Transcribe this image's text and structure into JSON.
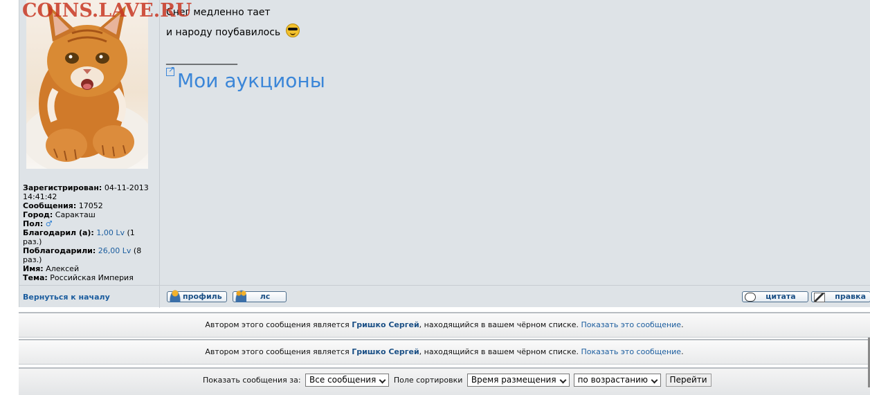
{
  "watermark": "COINS.LAVE.RU",
  "post": {
    "line1": "Снег медленно тает",
    "line2": "и народу поубавилось",
    "smiley_icon": "sunglasses-smiley",
    "signature_separator": "_________________",
    "auction_link": "Мои аукционы"
  },
  "profile": {
    "avatar_alt": "kitten-avatar",
    "registered_label": "Зарегистрирован:",
    "registered_value": "04-11-2013 14:41:42",
    "messages_label": "Сообщения:",
    "messages_value": "17052",
    "city_label": "Город:",
    "city_value": "Саракташ",
    "gender_label": "Пол:",
    "gender_value": "♂",
    "thanked_label": "Благодарил (а):",
    "thanked_amount": "1,00 Lv",
    "thanked_count": "(1 раз.)",
    "thanked_by_label": "Поблагодарили:",
    "thanked_by_amount": "26,00 Lv",
    "thanked_by_count": "(8 раз.)",
    "name_label": "Имя:",
    "name_value": "Алексей",
    "topic_label": "Тема:",
    "topic_value": "Российская Империя"
  },
  "footer": {
    "back_to_top": "Вернуться к началу",
    "profile_button": "профиль",
    "pm_button": "лс",
    "quote_button": "цитата",
    "edit_button": "правка"
  },
  "notices": [
    {
      "prefix": "Автором этого сообщения является ",
      "author": "Гришко Сергей",
      "middle": ", находящийся в вашем чёрном списке. ",
      "show_link": "Показать это сообщение",
      "suffix": "."
    },
    {
      "prefix": "Автором этого сообщения является ",
      "author": "Гришко Сергей",
      "middle": ", находящийся в вашем чёрном списке. ",
      "show_link": "Показать это сообщение",
      "suffix": "."
    }
  ],
  "controls": {
    "show_label": "Показать сообщения за:",
    "period_value": "Все сообщения",
    "sort_label": "Поле сортировки",
    "sort_field_value": "Время размещения",
    "sort_order_value": "по возрастанию",
    "go_button": "Перейти"
  },
  "colors": {
    "post_background": "#dee3e7",
    "link": "#1a5c9e",
    "auction_link": "#3b86d8",
    "watermark": "#c83723"
  }
}
